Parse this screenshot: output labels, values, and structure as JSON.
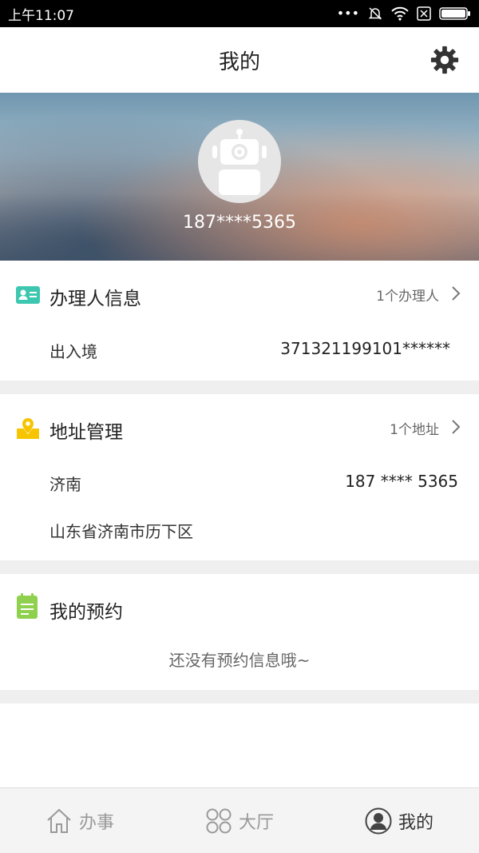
{
  "status_bar": {
    "time": "上午11:07",
    "icons": [
      "more-dots-icon",
      "mute-icon",
      "wifi-icon",
      "sim-off-icon",
      "battery-icon"
    ]
  },
  "header": {
    "title": "我的",
    "settings_icon": "gear-icon"
  },
  "profile": {
    "avatar_icon": "robot-avatar-icon",
    "phone": "187****5365"
  },
  "handler_section": {
    "icon": "id-card-icon",
    "title": "办理人信息",
    "meta": "1个办理人",
    "row_label": "出入境",
    "row_value": "371321199101******"
  },
  "address_section": {
    "icon": "location-pin-icon",
    "title": "地址管理",
    "meta": "1个地址",
    "name": "济南",
    "phone": "187 **** 5365",
    "address": "山东省济南市历下区"
  },
  "appointment_section": {
    "icon": "clipboard-icon",
    "title": "我的预约",
    "empty_text": "还没有预约信息哦~"
  },
  "tabbar": {
    "tabs": [
      {
        "label": "办事",
        "icon": "home-icon"
      },
      {
        "label": "大厅",
        "icon": "grid-circles-icon"
      },
      {
        "label": "我的",
        "icon": "user-icon",
        "active": true
      }
    ]
  },
  "colors": {
    "id_card_icon": "#3ec7b0",
    "location_icon": "#f7c400",
    "clipboard_icon": "#8fd14f"
  }
}
